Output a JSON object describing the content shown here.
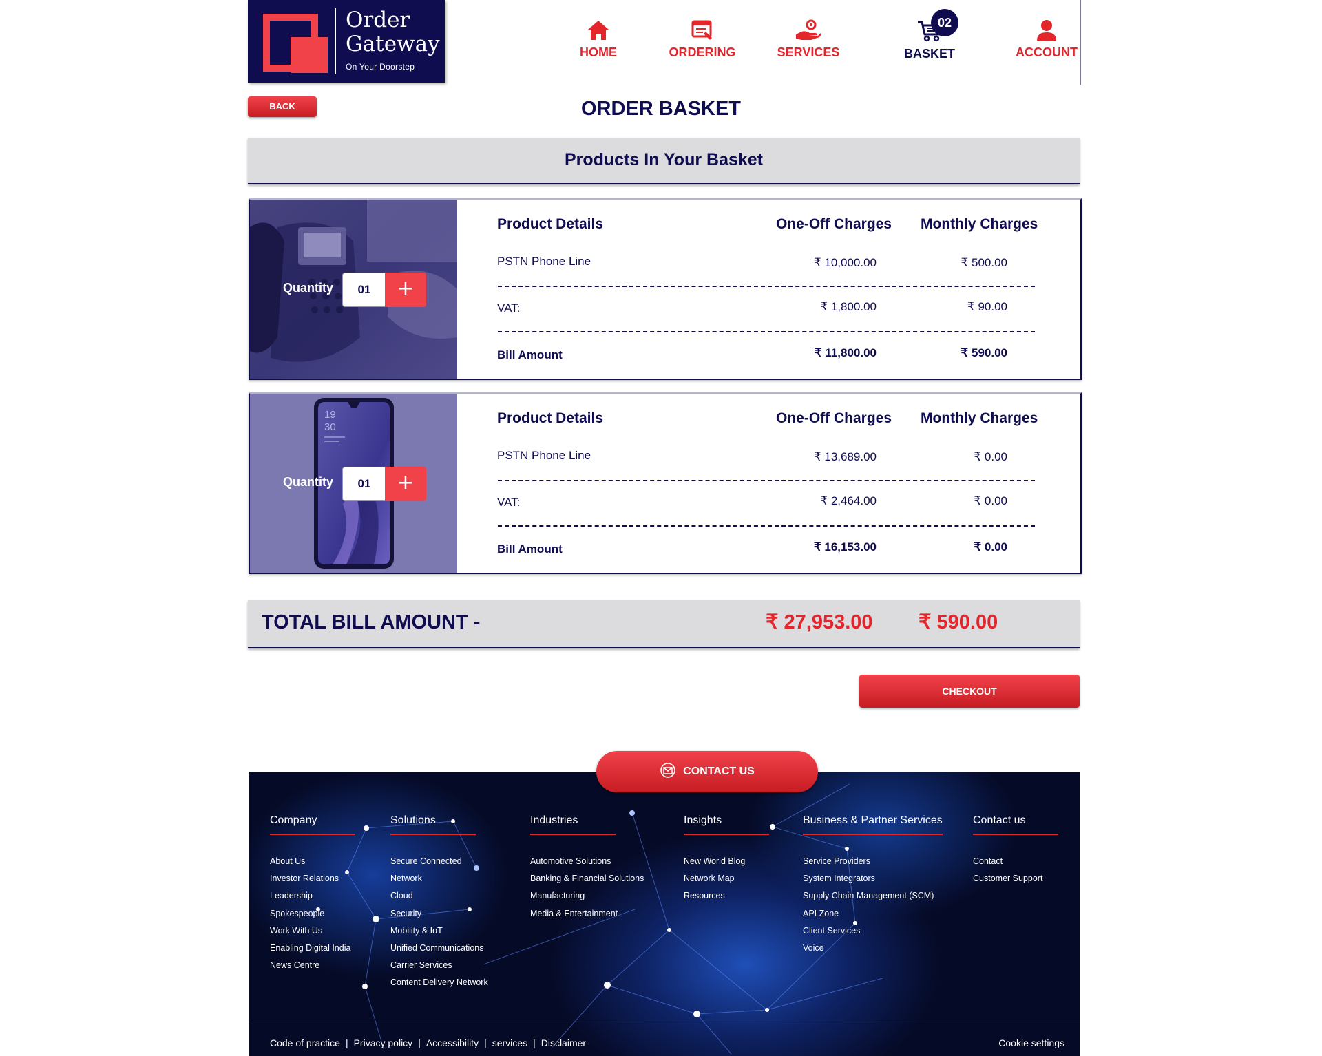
{
  "header": {
    "logo": {
      "title_line1": "Order",
      "title_line2": "Gateway",
      "tagline": "On Your Doorstep"
    },
    "nav": [
      {
        "label": "HOME",
        "icon": "home-icon"
      },
      {
        "label": "ORDERING",
        "icon": "ordering-icon"
      },
      {
        "label": "SERVICES",
        "icon": "services-icon"
      },
      {
        "label": "BASKET",
        "icon": "cart-icon",
        "badge": "02"
      },
      {
        "label": "ACCOUNT",
        "icon": "user-icon"
      }
    ]
  },
  "back_label": "BACK",
  "page_title": "ORDER BASKET",
  "products_heading": "Products In Your Basket",
  "columns": {
    "details": "Product Details",
    "one_off": "One-Off Charges",
    "monthly": "Monthly Charges"
  },
  "items": [
    {
      "image": "desk-phone-photo",
      "quantity_label": "Quantity",
      "quantity": "01",
      "name": "PSTN Phone Line",
      "one_off": "₹ 10,000.00",
      "monthly": "₹ 500.00",
      "vat_label": "VAT:",
      "vat_one_off": "₹ 1,800.00",
      "vat_monthly": "₹ 90.00",
      "bill_label": "Bill Amount",
      "bill_one_off": "₹ 11,800.00",
      "bill_monthly": "₹ 590.00"
    },
    {
      "image": "smartphone-photo",
      "phone_clock": [
        "19",
        "30"
      ],
      "quantity_label": "Quantity",
      "quantity": "01",
      "name": "PSTN Phone Line",
      "one_off": "₹ 13,689.00",
      "monthly": "₹ 0.00",
      "vat_label": "VAT:",
      "vat_one_off": "₹ 2,464.00",
      "vat_monthly": "₹ 0.00",
      "bill_label": "Bill Amount",
      "bill_one_off": "₹ 16,153.00",
      "bill_monthly": "₹ 0.00"
    }
  ],
  "total": {
    "label": "TOTAL BILL AMOUNT -",
    "one_off": "₹ 27,953.00",
    "monthly": "₹ 590.00"
  },
  "checkout_label": "CHECKOUT",
  "contact_label": "CONTACT US",
  "footer": {
    "columns": [
      {
        "heading": "Company",
        "links": [
          "About Us",
          "Investor Relations",
          "Leadership",
          "Spokespeople",
          "Work With Us",
          "Enabling Digital India",
          "News Centre"
        ]
      },
      {
        "heading": "Solutions",
        "links": [
          "Secure Connected",
          "Network",
          "Cloud",
          "Security",
          "Mobility & IoT",
          "Unified Communications",
          "Carrier Services",
          "Content Delivery Network"
        ]
      },
      {
        "heading": "Industries",
        "links": [
          "Automotive Solutions",
          "Banking & Financial Solutions",
          "Manufacturing",
          "Media & Entertainment"
        ]
      },
      {
        "heading": "Insights",
        "links": [
          "New World Blog",
          "Network Map",
          "Resources"
        ]
      },
      {
        "heading": "Business & Partner Services",
        "links": [
          "Service Providers",
          "System Integrators",
          "Supply Chain Management (SCM)",
          "API Zone",
          "Client Services",
          "Voice"
        ]
      },
      {
        "heading": "Contact us",
        "links": [
          "Contact",
          "Customer Support"
        ]
      }
    ],
    "legal_links": [
      "Code of practice",
      "Privacy policy",
      "Accessibility",
      "services",
      "Disclaimer"
    ],
    "legal_separator": "|",
    "cookie": "Cookie settings"
  },
  "colors": {
    "navy": "#0f0c4f",
    "red": "#e3252c",
    "panel_grey": "#dcdcdf"
  }
}
